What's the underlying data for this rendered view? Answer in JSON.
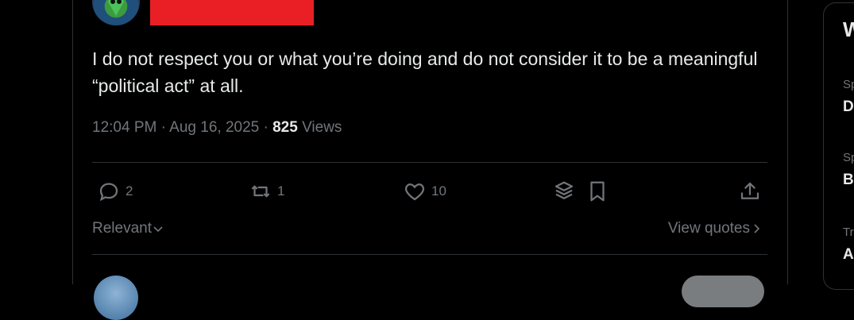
{
  "tweet": {
    "text": "I do not respect you or what you’re doing and do not consider it to be a meaningful “political act” at all.",
    "time": "12:04 PM",
    "sep": "·",
    "date": "Aug 16, 2025",
    "views_count": "825",
    "views_label": "Views"
  },
  "actions": {
    "replies": "2",
    "reposts": "1",
    "likes": "10"
  },
  "filters": {
    "relevant_label": "Relevant",
    "view_quotes_label": "View quotes"
  },
  "sidebar": {
    "title_fragment": "W",
    "items": [
      {
        "small": "Sp",
        "bold": "D"
      },
      {
        "small": "Sp",
        "bold": "B"
      },
      {
        "small": "Tr",
        "bold": "A"
      }
    ]
  },
  "colors": {
    "background": "#000000",
    "text": "#e7e9ea",
    "muted": "#71767b",
    "border": "#2f3336",
    "redaction": "#ea1f26"
  }
}
